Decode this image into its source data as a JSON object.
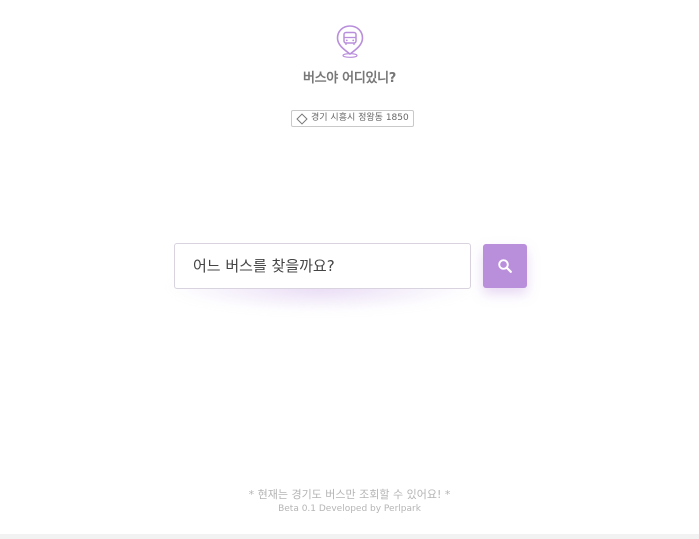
{
  "header": {
    "logo_icon": "bus-location-pin-icon",
    "title": "버스야 어디있니?",
    "accent_color": "#b98fdc"
  },
  "location": {
    "icon": "location-diamond-icon",
    "text": "경기 시흥시 정왕동 1850"
  },
  "search": {
    "placeholder": "어느 버스를 찾을까요?",
    "value": "",
    "button_icon": "search-icon"
  },
  "footer": {
    "notice": "* 현재는 경기도 버스만 조회할 수 있어요! *",
    "credit": "Beta 0.1 Developed by Perlpark"
  }
}
